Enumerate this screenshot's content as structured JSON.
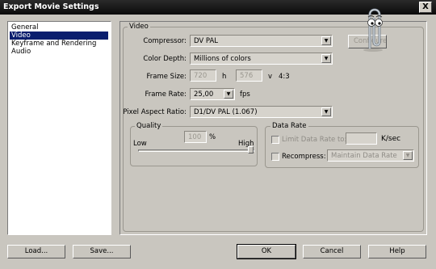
{
  "window": {
    "title": "Export Movie Settings",
    "close_glyph": "X"
  },
  "sidebar": {
    "items": [
      {
        "label": "General"
      },
      {
        "label": "Video"
      },
      {
        "label": "Keyframe and Rendering"
      },
      {
        "label": "Audio"
      }
    ],
    "selected": "Video"
  },
  "video": {
    "group_label": "Video",
    "compressor": {
      "label": "Compressor:",
      "value": "DV PAL"
    },
    "configure_button": "Configure...",
    "color_depth": {
      "label": "Color Depth:",
      "value": "Millions of colors"
    },
    "frame_size": {
      "label": "Frame Size:",
      "h_value": "720",
      "h_unit": "h",
      "v_value": "576",
      "v_unit": "v",
      "aspect": "4:3"
    },
    "frame_rate": {
      "label": "Frame Rate:",
      "value": "25,00",
      "unit": "fps"
    },
    "pixel_aspect": {
      "label": "Pixel Aspect Ratio:",
      "value": "D1/DV PAL (1.067)"
    },
    "quality": {
      "group_label": "Quality",
      "value": "100",
      "unit": "%",
      "low_label": "Low",
      "high_label": "High",
      "level_percent": 100
    },
    "data_rate": {
      "group_label": "Data Rate",
      "limit_label": "Limit Data Rate to:",
      "limit_value": "",
      "limit_unit": "K/sec",
      "recompress_label": "Recompress:",
      "recompress_option": "Maintain Data Rate"
    }
  },
  "buttons": {
    "load": "Load...",
    "save": "Save...",
    "ok": "OK",
    "cancel": "Cancel",
    "help": "Help"
  },
  "assistant": {
    "icon": "paperclip-assistant-icon"
  }
}
